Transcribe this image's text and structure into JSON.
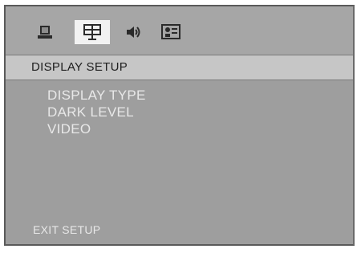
{
  "toolbar": {
    "tabs": [
      {
        "icon": "general-setup-icon"
      },
      {
        "icon": "display-setup-icon",
        "selected": true
      },
      {
        "icon": "audio-setup-icon"
      },
      {
        "icon": "preference-setup-icon"
      }
    ]
  },
  "header": {
    "title": "DISPLAY SETUP"
  },
  "menu": {
    "items": [
      {
        "label": "DISPLAY TYPE"
      },
      {
        "label": "DARK LEVEL"
      },
      {
        "label": "VIDEO"
      }
    ]
  },
  "footer": {
    "exit_label": "EXIT SETUP"
  },
  "colors": {
    "panel": "#9e9e9e",
    "header": "#c6c6c6",
    "selected_tab": "#f2f2f2",
    "text": "#e8e8e8"
  }
}
